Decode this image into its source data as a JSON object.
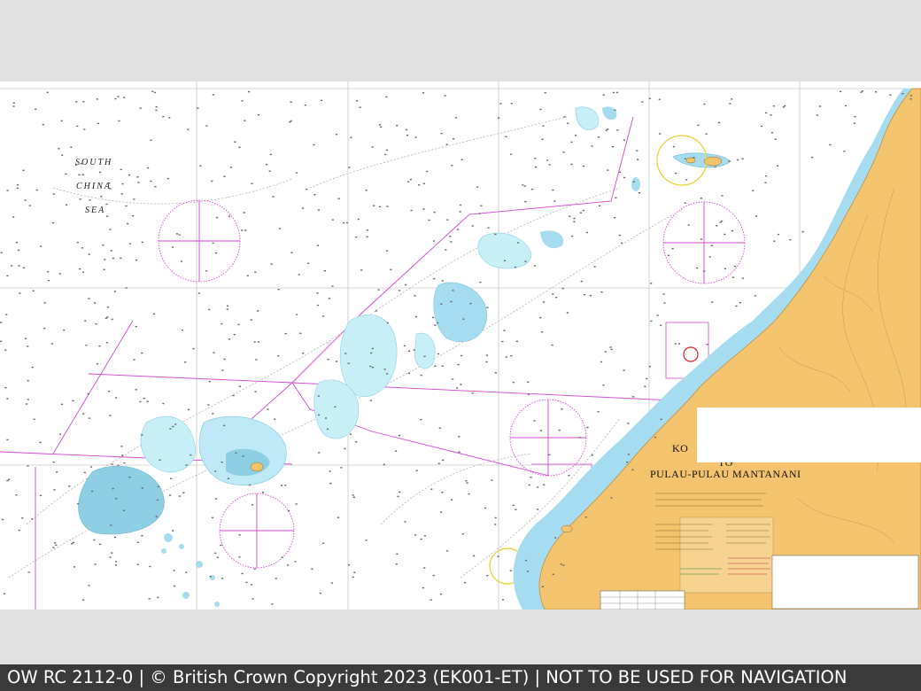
{
  "viewer": {
    "footer_text": "OW RC 2112-0 | © British Crown Copyright 2023 (EK001-ET) | NOT TO BE USED FOR NAVIGATION"
  },
  "chart": {
    "sea_label": [
      "SOUTH",
      "CHINA",
      "SEA"
    ],
    "title_partial": "KO",
    "title_to": "TO",
    "title_main": "PULAU-PULAU MANTANANI",
    "colors": {
      "land": "#f3c36d",
      "shallow_water": "#a6dcef",
      "reef_water": "#c8eef8",
      "sea": "#ffffff",
      "magenta_lines": "#d24ad2",
      "grid": "#9a9a9a"
    },
    "icons": [
      "compass-rose-icon",
      "mooring-circle-icon"
    ]
  }
}
